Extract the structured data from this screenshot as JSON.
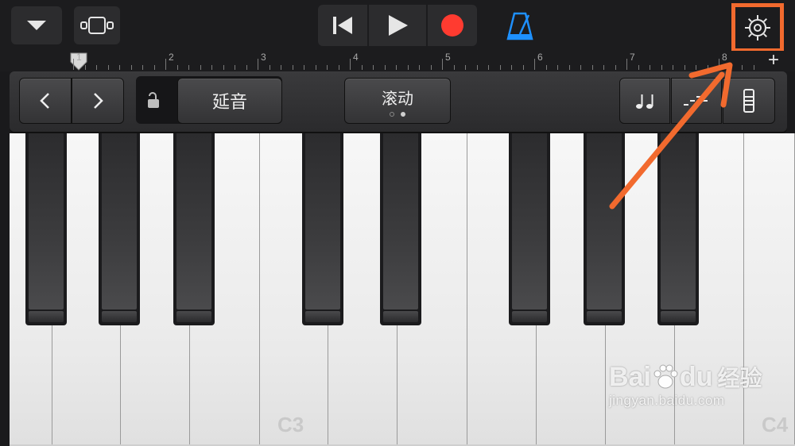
{
  "toolbar": {
    "icons": [
      "chevron-down-icon",
      "view-toggle-icon",
      "go-to-start-icon",
      "play-icon",
      "record-icon",
      "metronome-icon",
      "settings-gear-icon"
    ],
    "record_color": "#ff3b30",
    "metronome_color": "#1e90ff",
    "highlight_color": "#f26a2e"
  },
  "ruler": {
    "bars": [
      "1",
      "2",
      "3",
      "4",
      "5",
      "6",
      "7",
      "8"
    ],
    "add_label": "+"
  },
  "controls": {
    "sustain_label": "延音",
    "scroll_label": "滚动",
    "icons": [
      "chevron-left-icon",
      "chevron-right-icon",
      "lock-open-icon",
      "notes-icon",
      "arpeggiator-icon",
      "keyboard-layout-icon"
    ]
  },
  "keyboard": {
    "label_c3": "C3",
    "label_c4": "C4"
  },
  "watermark": {
    "brand": "Bai",
    "brand2": "du",
    "cn": "经验",
    "url": "jingyan.baidu.com"
  }
}
